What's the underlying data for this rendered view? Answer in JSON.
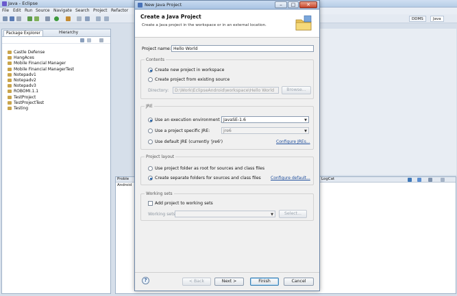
{
  "eclipse": {
    "title": "Java - Eclipse",
    "menu": [
      "File",
      "Edit",
      "Run",
      "Source",
      "Navigate",
      "Search",
      "Project",
      "Refactor"
    ],
    "perspectives": [
      "DDMS",
      "Java"
    ],
    "package_explorer": {
      "tabs": [
        "Package Explorer",
        "Hierarchy"
      ],
      "items": [
        "Castle Defense",
        "HangAces",
        "Mobile Financial Manager",
        "Mobile Financial ManagerTest",
        "Notepadv1",
        "Notepadv2",
        "Notepadv3",
        "ROBOMI.1.1",
        "TestProject",
        "TestProjectTest",
        "Testing"
      ]
    },
    "console": {
      "tab_label": "Android",
      "problems_tab": "Proble",
      "logcat_tab": "LogCat"
    }
  },
  "dialog": {
    "title": "New Java Project",
    "header_title": "Create a Java Project",
    "header_desc": "Create a Java project in the workspace or in an external location.",
    "project_name_label": "Project name:",
    "project_name_value": "Hello World",
    "contents": {
      "label": "Contents",
      "option_new": "Create new project in workspace",
      "option_existing": "Create project from existing source",
      "directory_label": "Directory:",
      "directory_value": "D:\\Work\\EclipseAndroid\\workspace\\Hello World",
      "browse": "Browse..."
    },
    "jre": {
      "label": "JRE",
      "option_env": "Use an execution environment JRE:",
      "env_value": "JavaSE-1.6",
      "option_specific": "Use a project specific JRE:",
      "specific_value": "jre6",
      "option_default": "Use default JRE (currently 'jre6')",
      "configure_link": "Configure JREs..."
    },
    "layout": {
      "label": "Project layout",
      "option_root": "Use project folder as root for sources and class files",
      "option_separate": "Create separate folders for sources and class files",
      "configure_link": "Configure default..."
    },
    "working_sets": {
      "label": "Working sets",
      "add_label": "Add project to working sets",
      "sets_label": "Working sets:",
      "select": "Select..."
    },
    "buttons": {
      "back": "< Back",
      "next": "Next >",
      "finish": "Finish",
      "cancel": "Cancel"
    }
  }
}
